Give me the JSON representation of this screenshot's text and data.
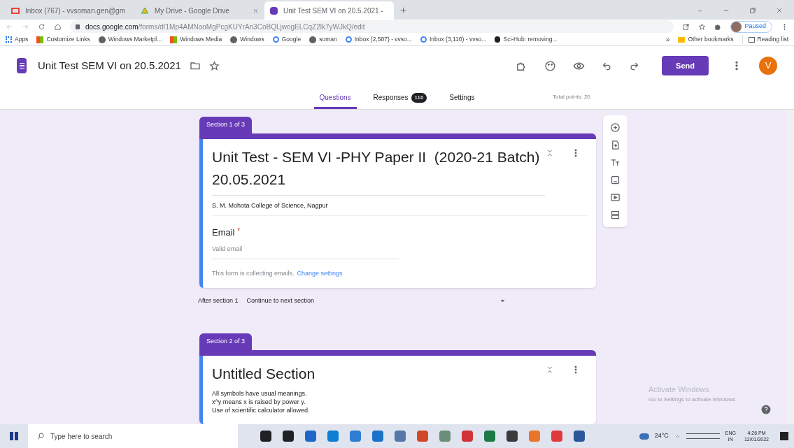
{
  "browser": {
    "tabs": [
      {
        "title": "Inbox (767) - vvsoman.gen@gm",
        "kind": "mail",
        "selected": false
      },
      {
        "title": "My Drive - Google Drive",
        "kind": "drive",
        "selected": false
      },
      {
        "title": "Unit Test SEM VI on 20.5.2021 - ",
        "kind": "forms",
        "selected": true
      }
    ],
    "url_host": "docs.google.com",
    "url_path": "/forms/d/1Mp4AMNaoMgPcgKUYrAn3CoBQLjwogELCqZ2lk7yWJkQ/edit",
    "profile_status": "Paused",
    "bookmarks": [
      {
        "label": "Apps",
        "kind": "apps"
      },
      {
        "label": "Customize Links",
        "kind": "ms"
      },
      {
        "label": "Windows Marketpl...",
        "kind": "globe"
      },
      {
        "label": "Windows Media",
        "kind": "ms"
      },
      {
        "label": "Windows",
        "kind": "globe"
      },
      {
        "label": "Google",
        "kind": "g"
      },
      {
        "label": "soman",
        "kind": "globe"
      },
      {
        "label": "Inbox (2,507) - vvso...",
        "kind": "g"
      },
      {
        "label": "Inbox (3,110) - vvso...",
        "kind": "g"
      },
      {
        "label": "Sci-Hub: removing...",
        "kind": "bird"
      }
    ],
    "overflow": "»",
    "other_bookmarks": "Other bookmarks",
    "reading_list": "Reading list"
  },
  "form_header": {
    "title": "Unit Test SEM VI on 20.5.2021",
    "send": "Send",
    "avatar": "V",
    "tabs": [
      {
        "label": "Questions",
        "selected": true
      },
      {
        "label": "Responses",
        "badge": "116",
        "selected": false
      },
      {
        "label": "Settings",
        "selected": false
      }
    ],
    "total_points": "Total points: 20"
  },
  "sections": [
    {
      "tab": "Section 1 of 3",
      "title": "Unit Test - SEM VI -PHY Paper II  (2020-21 Batch)   20.05.2021",
      "description": [
        "S. M. Mohota College of Science, Nagpur"
      ],
      "email": {
        "label": "Email",
        "required_mark": "*",
        "placeholder": "Valid email",
        "note": "This form is collecting emails.",
        "link": "Change settings"
      },
      "after": {
        "label": "After section 1",
        "value": "Continue to next section"
      }
    },
    {
      "tab": "Section 2 of 3",
      "title": "Untitled Section",
      "description": [
        "All symbols have usual meanings.",
        "x^y means x is raised by power y.",
        "Use of scientific calculator allowed."
      ]
    }
  ],
  "activation": {
    "title": "Activate Windows",
    "note": "Go to Settings to activate Windows."
  },
  "taskbar": {
    "search": "Type here to search",
    "weather": "24°C",
    "lang": "ENG",
    "region": "IN",
    "time": "4:26 PM",
    "date": "12/01/2022"
  }
}
